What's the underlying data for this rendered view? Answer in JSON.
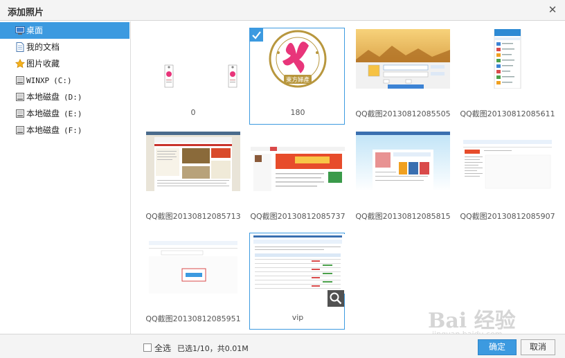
{
  "dialog": {
    "title": "添加照片",
    "close_glyph": "✕"
  },
  "sidebar": {
    "items": [
      {
        "label": "桌面",
        "drive": "",
        "icon": "desktop-icon"
      },
      {
        "label": "我的文档",
        "drive": "",
        "icon": "document-icon"
      },
      {
        "label": "图片收藏",
        "drive": "",
        "icon": "star-icon"
      },
      {
        "label": "WINXP",
        "drive": "(C:)",
        "icon": "drive-icon"
      },
      {
        "label": "本地磁盘",
        "drive": "(D:)",
        "icon": "drive-icon"
      },
      {
        "label": "本地磁盘",
        "drive": "(E:)",
        "icon": "drive-icon"
      },
      {
        "label": "本地磁盘",
        "drive": "(F:)",
        "icon": "drive-icon"
      }
    ]
  },
  "photos": [
    {
      "caption": "0"
    },
    {
      "caption": "180"
    },
    {
      "caption": "QQ截图20130812085505"
    },
    {
      "caption": "QQ截图20130812085611"
    },
    {
      "caption": "QQ截图20130812085713"
    },
    {
      "caption": "QQ截图20130812085737"
    },
    {
      "caption": "QQ截图20130812085815"
    },
    {
      "caption": "QQ截图20130812085907"
    },
    {
      "caption": "QQ截图20130812085951"
    },
    {
      "caption": "vip"
    }
  ],
  "logo": {
    "cn_text": "東方婦產"
  },
  "footer": {
    "select_all_label": "全选",
    "selection_info": "已选1/10，共0.01M",
    "ok_label": "确定",
    "cancel_label": "取消"
  },
  "watermark": {
    "text": "Bai 经验",
    "url": "jingyan.baidu.com"
  },
  "colors": {
    "accent": "#3c9ae0",
    "logo_pink": "#e8357a",
    "logo_gold": "#b8973e"
  }
}
